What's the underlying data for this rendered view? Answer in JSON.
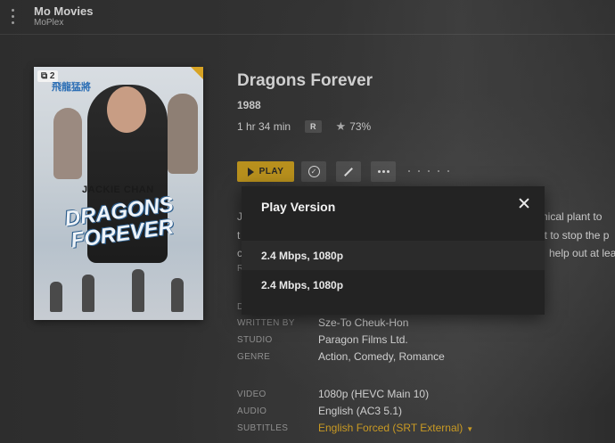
{
  "header": {
    "library_title": "Mo Movies",
    "server_name": "MoPlex"
  },
  "poster": {
    "version_count": "2",
    "actor_text": "JACKIE CHAN",
    "title_text": "DRAGONS FOREVER",
    "chinese_title": "飛龍猛將"
  },
  "movie": {
    "title": "Dragons Forever",
    "year": "1988",
    "duration": "1 hr 34 min",
    "content_rating": "R",
    "score": "73%"
  },
  "actions": {
    "play_label": "PLAY"
  },
  "summary_fragments": {
    "line1_left": "J",
    "line1_right": "emical plant to",
    "line2_left": "t",
    "line2_right": "ut to stop the p",
    "line3_left": "c",
    "line3_right": "help out at lea",
    "line4_left": "R",
    "line5_left": "D"
  },
  "details": {
    "written_by_label": "WRITTEN BY",
    "written_by": "Sze-To Cheuk-Hon",
    "studio_label": "STUDIO",
    "studio": "Paragon Films Ltd.",
    "genre_label": "GENRE",
    "genre": "Action, Comedy, Romance",
    "video_label": "VIDEO",
    "video": "1080p (HEVC Main 10)",
    "audio_label": "AUDIO",
    "audio": "English (AC3 5.1)",
    "subtitles_label": "SUBTITLES",
    "subtitles": "English Forced (SRT External)"
  },
  "modal": {
    "title": "Play Version",
    "versions": [
      {
        "label": "2.4 Mbps, 1080p"
      },
      {
        "label": "2.4 Mbps, 1080p"
      }
    ]
  },
  "colors": {
    "accent": "#b8901d",
    "accent_text": "#c99a23",
    "modal_bg": "#232323"
  }
}
